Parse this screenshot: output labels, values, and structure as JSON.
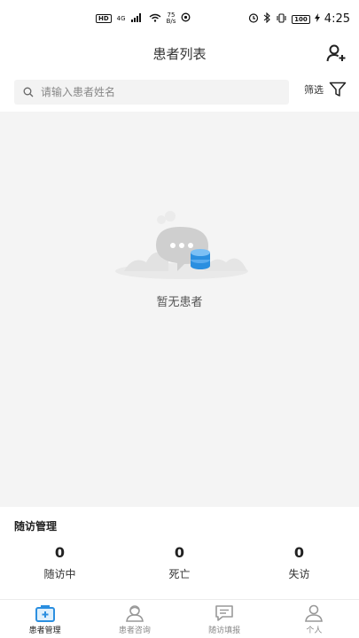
{
  "status_bar": {
    "sim_badge": "HD",
    "network": "4G",
    "speed_value": "75",
    "speed_unit": "B/s",
    "battery": "100",
    "time": "4:25"
  },
  "header": {
    "title": "患者列表"
  },
  "search": {
    "placeholder": "请输入患者姓名"
  },
  "filter": {
    "label": "筛选"
  },
  "empty_state": {
    "text": "暂无患者"
  },
  "stats": {
    "title": "随访管理",
    "items": [
      {
        "value": "0",
        "label": "随访中"
      },
      {
        "value": "0",
        "label": "死亡"
      },
      {
        "value": "0",
        "label": "失访"
      }
    ]
  },
  "tabs": [
    {
      "label": "患者管理",
      "icon": "medical-kit-icon"
    },
    {
      "label": "患者咨询",
      "icon": "consult-icon"
    },
    {
      "label": "随访填报",
      "icon": "message-icon"
    },
    {
      "label": "个人",
      "icon": "person-icon"
    }
  ],
  "colors": {
    "accent": "#2b8fe0",
    "background": "#f4f4f4"
  }
}
